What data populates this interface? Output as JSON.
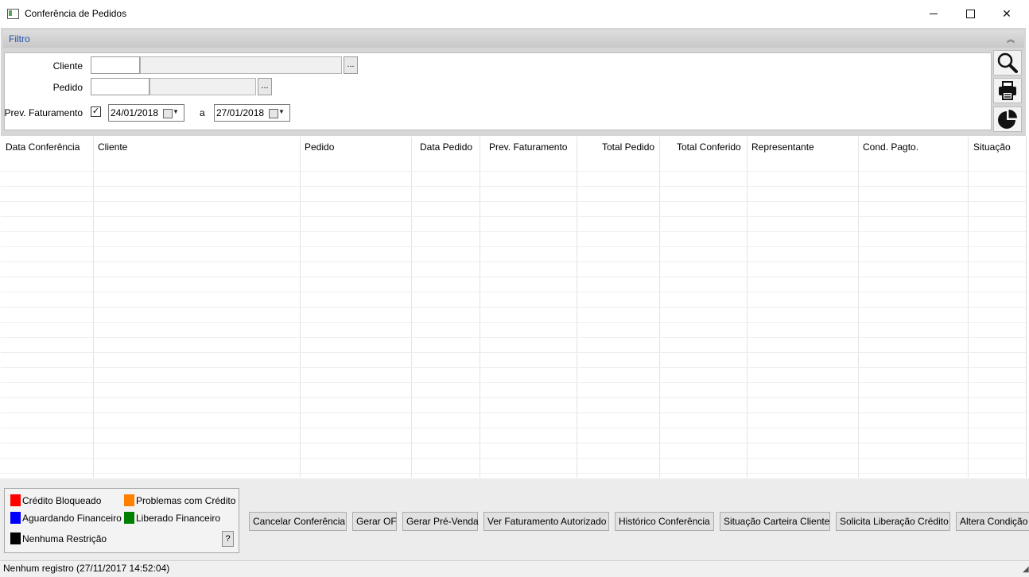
{
  "window": {
    "title": "Conferência de Pedidos",
    "minimize": "—",
    "maximize": "☐",
    "close": "✕"
  },
  "filter": {
    "title": "Filtro",
    "collapse_icon": "︽",
    "cliente_label": "Cliente",
    "pedido_label": "Pedido",
    "prev_label": "Prev. Faturamento",
    "prev_checked": "✓",
    "date_from": "24/01/2018",
    "range_sep": "a",
    "date_to": "27/01/2018",
    "ellipsis": "..."
  },
  "grid": {
    "columns": [
      "Data Conferência",
      "Cliente",
      "Pedido",
      "Data Pedido",
      "Prev. Faturamento",
      "Total Pedido",
      "Total Conferido",
      "Representante",
      "Cond. Pagto.",
      "Situação"
    ]
  },
  "legend": [
    {
      "label": "Crédito Bloqueado",
      "color": "#ff0000"
    },
    {
      "label": "Problemas com Crédito",
      "color": "#ff8000"
    },
    {
      "label": "Aguardando Financeiro",
      "color": "#0000ff"
    },
    {
      "label": "Liberado Financeiro",
      "color": "#008000"
    },
    {
      "label": "Nenhuma Restrição",
      "color": "#000000"
    }
  ],
  "help_label": "?",
  "actions": [
    "Cancelar Conferência",
    "Gerar OF",
    "Gerar Pré-Venda",
    "Ver Faturamento Autorizado",
    "Histórico Conferência",
    "Situação Carteira Cliente",
    "Solicita Liberação Crédito",
    "Altera Condição"
  ],
  "status": {
    "text": "Nenhum registro (27/11/2017 14:52:04)"
  }
}
